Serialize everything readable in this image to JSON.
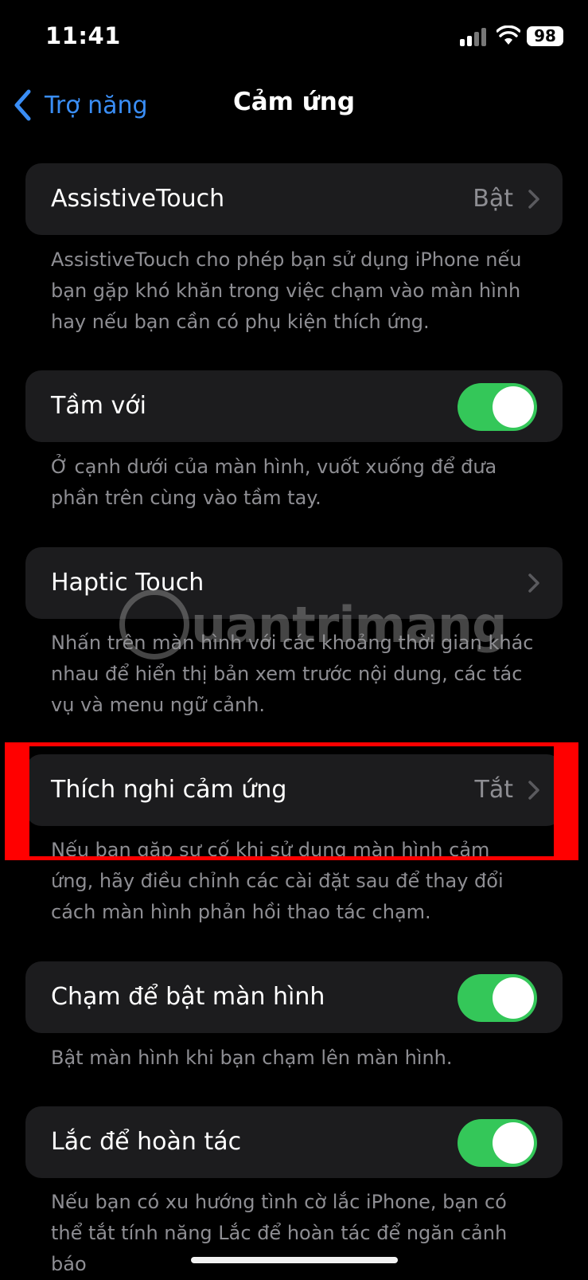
{
  "status": {
    "time": "11:41",
    "battery": "98"
  },
  "nav": {
    "back_label": "Trợ năng",
    "title": "Cảm ứng"
  },
  "rows": {
    "assistive": {
      "label": "AssistiveTouch",
      "value": "Bật",
      "footer": "AssistiveTouch cho phép bạn sử dụng iPhone nếu bạn gặp khó khăn trong việc chạm vào màn hình hay nếu bạn cần có phụ kiện thích ứng."
    },
    "reach": {
      "label": "Tầm với",
      "toggle_on": true,
      "footer": "Ở cạnh dưới của màn hình, vuốt xuống để đưa phần trên cùng vào tầm tay."
    },
    "haptic": {
      "label": "Haptic Touch",
      "footer": "Nhấn trên màn hình với các khoảng thời gian khác nhau để hiển thị bản xem trước nội dung, các tác vụ và menu ngữ cảnh."
    },
    "accommodations": {
      "label": "Thích nghi cảm ứng",
      "value": "Tắt",
      "footer": "Nếu bạn gặp sự cố khi sử dụng màn hình cảm ứng, hãy điều chỉnh các cài đặt sau để thay đổi cách màn hình phản hồi thao tác chạm."
    },
    "tap_wake": {
      "label": "Chạm để bật màn hình",
      "toggle_on": true,
      "footer": "Bật màn hình khi bạn chạm lên màn hình."
    },
    "shake_undo": {
      "label": "Lắc để hoàn tác",
      "toggle_on": true,
      "footer": "Nếu bạn có xu hướng tình cờ lắc iPhone, bạn có thể tắt tính năng Lắc để hoàn tác để ngăn cảnh báo"
    }
  },
  "watermark": "uantrimang",
  "colors": {
    "accent": "#3a8ef6",
    "toggle_on": "#34c759",
    "cell_bg": "#1c1c1e",
    "secondary_text": "#8e8e93",
    "highlight": "#ff0000"
  }
}
